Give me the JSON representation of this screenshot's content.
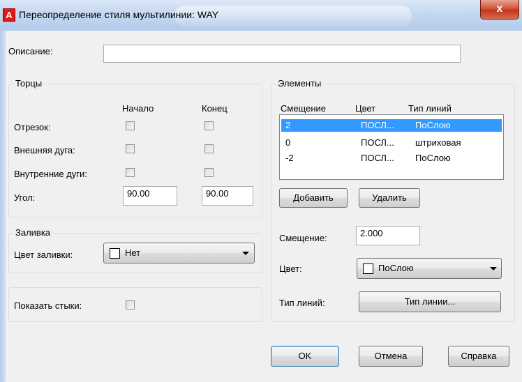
{
  "window": {
    "title": "Переопределение стиля мультилинии: WAY",
    "app_icon_letter": "A",
    "close_glyph": "x"
  },
  "description": {
    "label": "Описание:",
    "value": ""
  },
  "caps": {
    "title": "Торцы",
    "col_start": "Начало",
    "col_end": "Конец",
    "rows": [
      {
        "label": "Отрезок:",
        "start_checked": false,
        "end_checked": false
      },
      {
        "label": "Внешняя дуга:",
        "start_checked": false,
        "end_checked": false
      },
      {
        "label": "Внутренние дуги:",
        "start_checked": false,
        "end_checked": false
      }
    ],
    "angle_label": "Угол:",
    "angle_start": "90.00",
    "angle_end": "90.00"
  },
  "fill": {
    "title": "Заливка",
    "color_label": "Цвет заливки:",
    "color_value": "Нет"
  },
  "joints": {
    "label": "Показать стыки:",
    "checked": false
  },
  "elements": {
    "title": "Элементы",
    "columns": [
      "Смещение",
      "Цвет",
      "Тип линий"
    ],
    "rows": [
      {
        "offset": "2",
        "color": "ПОСЛ...",
        "linetype": "ПоСлою",
        "selected": true
      },
      {
        "offset": "0",
        "color": "ПОСЛ...",
        "linetype": "штриховая",
        "selected": false
      },
      {
        "offset": "-2",
        "color": "ПОСЛ...",
        "linetype": "ПоСлою",
        "selected": false
      }
    ],
    "add_button": "Добавить",
    "delete_button": "Удалить",
    "offset_label": "Смещение:",
    "offset_value": "2.000",
    "color_label": "Цвет:",
    "color_value": "ПоСлою",
    "linetype_label": "Тип линий:",
    "linetype_button": "Тип линии..."
  },
  "footer": {
    "ok": "OK",
    "cancel": "Отмена",
    "help": "Справка"
  },
  "colors": {
    "selection": "#3399ff",
    "close_button": "#c2351c",
    "app_icon": "#e01818"
  }
}
